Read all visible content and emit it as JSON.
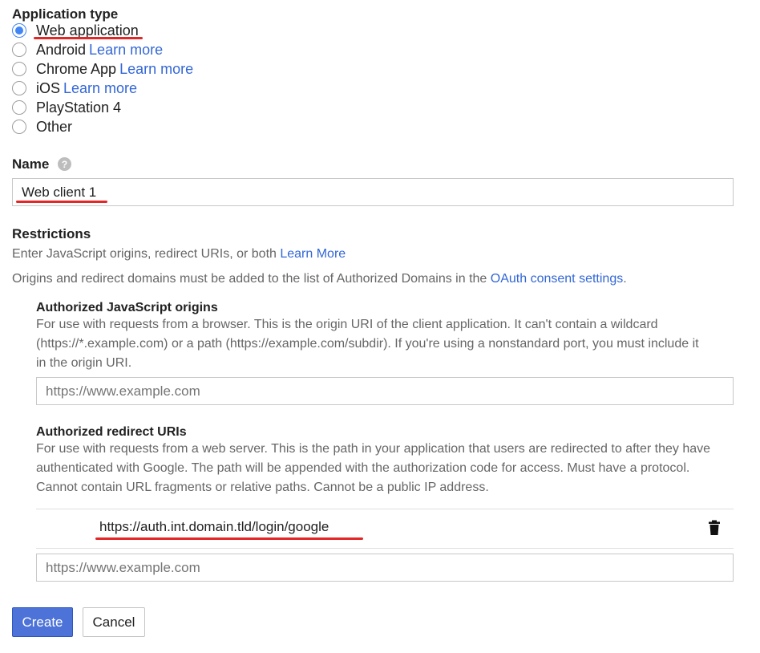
{
  "app_type": {
    "title": "Application type",
    "options": [
      {
        "label": "Web application",
        "link": "",
        "selected": true
      },
      {
        "label": "Android",
        "link": "Learn more",
        "selected": false
      },
      {
        "label": "Chrome App",
        "link": "Learn more",
        "selected": false
      },
      {
        "label": "iOS",
        "link": "Learn more",
        "selected": false
      },
      {
        "label": "PlayStation 4",
        "link": "",
        "selected": false
      },
      {
        "label": "Other",
        "link": "",
        "selected": false
      }
    ]
  },
  "name": {
    "label": "Name",
    "help_icon": "?",
    "value": "Web client 1"
  },
  "restrictions": {
    "title": "Restrictions",
    "desc_text": "Enter JavaScript origins, redirect URIs, or both",
    "desc_link": "Learn More",
    "domains_text": "Origins and redirect domains must be added to the list of Authorized Domains in the",
    "domains_link": "OAuth consent settings",
    "domains_end": "."
  },
  "js_origins": {
    "title": "Authorized JavaScript origins",
    "help_line1": "For use with requests from a browser. This is the origin URI of the client application. It can't contain a wildcard",
    "help_line2": "(https://*.example.com) or a path (https://example.com/subdir). If you're using a nonstandard port, you must include it",
    "help_line3": "in the origin URI.",
    "placeholder": "https://www.example.com"
  },
  "redirect_uris": {
    "title": "Authorized redirect URIs",
    "help_line1": "For use with requests from a web server. This is the path in your application that users are redirected to after they have",
    "help_line2": "authenticated with Google. The path will be appended with the authorization code for access. Must have a protocol.",
    "help_line3": "Cannot contain URL fragments or relative paths. Cannot be a public IP address.",
    "entry": "https://auth.int.domain.tld/login/google",
    "delete_icon": "trash-icon",
    "placeholder": "https://www.example.com"
  },
  "actions": {
    "create_label": "Create",
    "cancel_label": "Cancel"
  },
  "colors": {
    "accent": "#4285f4",
    "link": "#3367d6",
    "primary_button": "#4d73d8",
    "annotation_underline": "#e32626"
  }
}
